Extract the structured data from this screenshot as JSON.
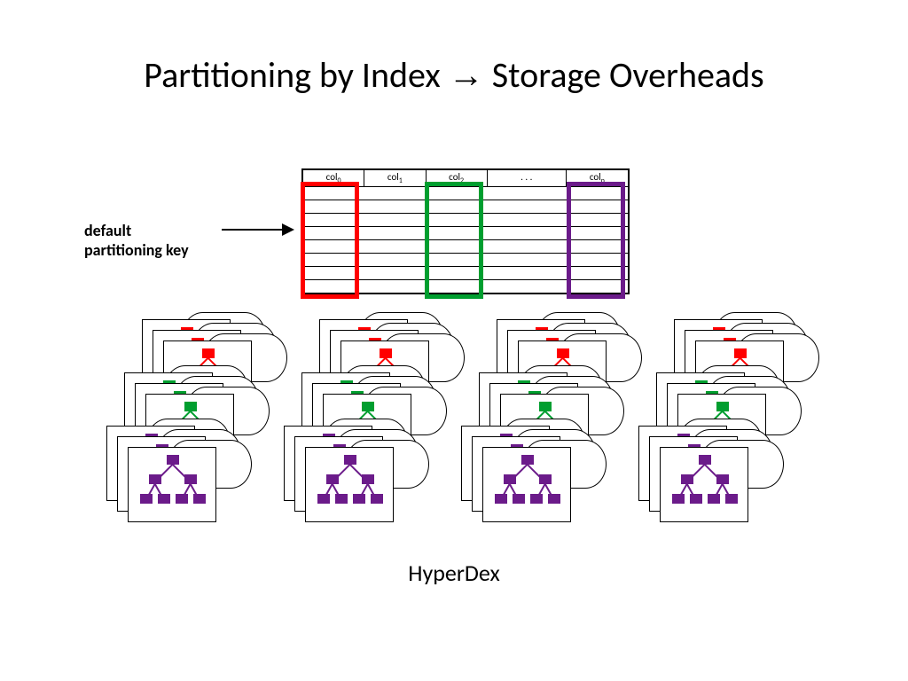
{
  "title": {
    "left": "Partitioning by Index",
    "arrow": "→",
    "right": "Storage Overheads"
  },
  "label_default": {
    "l1": "default",
    "l2": "partitioning key"
  },
  "table": {
    "cols": [
      {
        "name": "col",
        "sub": "0"
      },
      {
        "name": "col",
        "sub": "1"
      },
      {
        "name": "col",
        "sub": "2"
      },
      {
        "name": ". . .",
        "sub": ""
      },
      {
        "name": "col",
        "sub": "n"
      }
    ],
    "row_count": 8
  },
  "highlights": {
    "red": {
      "col": 0
    },
    "green": {
      "col": 2
    },
    "purple": {
      "col": 4
    }
  },
  "caption": "HyperDex"
}
